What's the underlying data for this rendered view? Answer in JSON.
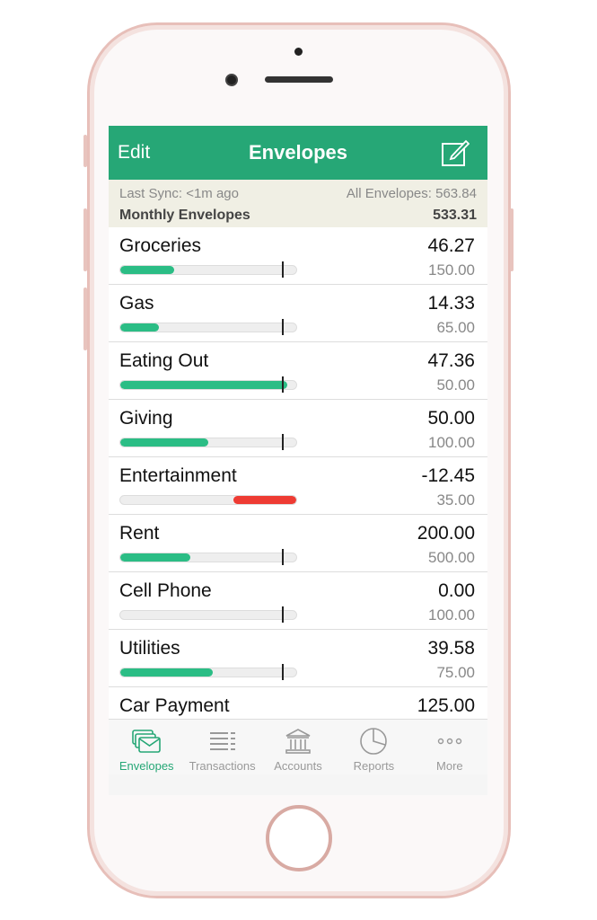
{
  "nav": {
    "edit": "Edit",
    "title": "Envelopes",
    "compose_icon": "compose-icon"
  },
  "summary": {
    "last_sync": "Last Sync: <1m ago",
    "all_envelopes": "All Envelopes: 563.84",
    "group": "Monthly Envelopes",
    "group_total": "533.31"
  },
  "colors": {
    "brand": "#26a776",
    "fill": "#2bbd85",
    "over": "#ee3b33"
  },
  "envelopes": [
    {
      "name": "Groceries",
      "amount": "46.27",
      "budget": "150.00",
      "value": 46.27,
      "limit": 150
    },
    {
      "name": "Gas",
      "amount": "14.33",
      "budget": "65.00",
      "value": 14.33,
      "limit": 65
    },
    {
      "name": "Eating Out",
      "amount": "47.36",
      "budget": "50.00",
      "value": 47.36,
      "limit": 50
    },
    {
      "name": "Giving",
      "amount": "50.00",
      "budget": "100.00",
      "value": 50,
      "limit": 100
    },
    {
      "name": "Entertainment",
      "amount": "-12.45",
      "budget": "35.00",
      "value": -12.45,
      "limit": 35
    },
    {
      "name": "Rent",
      "amount": "200.00",
      "budget": "500.00",
      "value": 200,
      "limit": 500
    },
    {
      "name": "Cell Phone",
      "amount": "0.00",
      "budget": "100.00",
      "value": 0,
      "limit": 100
    },
    {
      "name": "Utilities",
      "amount": "39.58",
      "budget": "75.00",
      "value": 39.58,
      "limit": 75
    },
    {
      "name": "Car Payment",
      "amount": "125.00",
      "budget": "",
      "value": 125,
      "limit": null
    }
  ],
  "tabs": [
    {
      "label": "Envelopes",
      "icon": "envelopes-icon",
      "active": true
    },
    {
      "label": "Transactions",
      "icon": "list-icon"
    },
    {
      "label": "Accounts",
      "icon": "bank-icon"
    },
    {
      "label": "Reports",
      "icon": "pie-chart-icon"
    },
    {
      "label": "More",
      "icon": "more-icon"
    }
  ]
}
